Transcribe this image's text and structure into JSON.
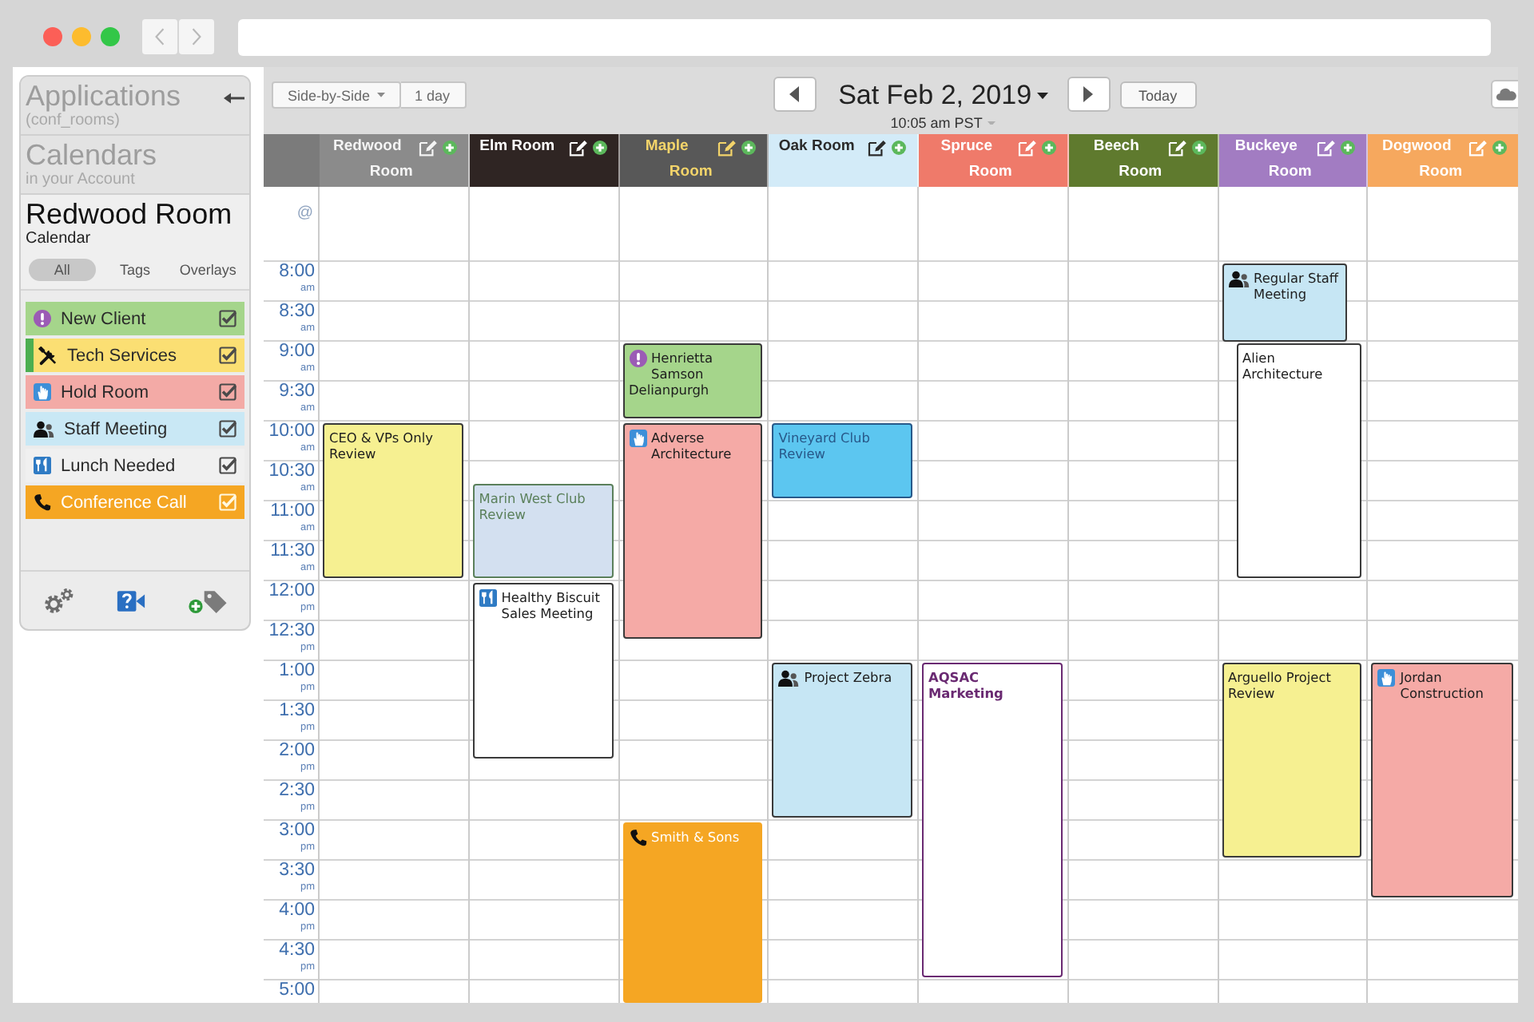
{
  "sidebar": {
    "sections": [
      {
        "title": "Applications",
        "subtitle": "(conf_rooms)",
        "selected": false,
        "collapse_arrow": true
      },
      {
        "title": "Calendars",
        "subtitle": "in your Account",
        "selected": false
      },
      {
        "title": "Redwood Room",
        "subtitle": "Calendar",
        "selected": true
      }
    ],
    "filters": [
      {
        "label": "All",
        "selected": true
      },
      {
        "label": "Tags",
        "selected": false
      },
      {
        "label": "Overlays",
        "selected": false
      }
    ],
    "tags": [
      {
        "label": "New Client",
        "kind": "new_client",
        "color": "#a5d58b",
        "checked": true,
        "selected": false
      },
      {
        "label": "Tech Services",
        "kind": "tech_services",
        "color": "#fbdf73",
        "checked": true,
        "selected": true
      },
      {
        "label": "Hold Room",
        "kind": "hold_room",
        "color": "#f3aaa6",
        "checked": true,
        "selected": false
      },
      {
        "label": "Staff Meeting",
        "kind": "staff_meeting",
        "color": "#c9e8f5",
        "checked": true,
        "selected": false
      },
      {
        "label": "Lunch Needed",
        "kind": "lunch_needed",
        "color": "#f0f0f0",
        "checked": true,
        "selected": false
      },
      {
        "label": "Conference Call",
        "kind": "conference_call",
        "color": "#f5a623",
        "checked": true,
        "selected": false
      }
    ]
  },
  "toolbar": {
    "views": [
      {
        "label": "Side-by-Side",
        "has_menu": true
      },
      {
        "label": "1 day"
      }
    ],
    "date": "Sat Feb 2, 2019",
    "timezone": "10:05 am PST",
    "today": "Today"
  },
  "calendar": {
    "all_day_marker": "@",
    "time_slots": [
      {
        "time": "8:00",
        "meridiem": "am"
      },
      {
        "time": "8:30",
        "meridiem": "am"
      },
      {
        "time": "9:00",
        "meridiem": "am"
      },
      {
        "time": "9:30",
        "meridiem": "am"
      },
      {
        "time": "10:00",
        "meridiem": "am"
      },
      {
        "time": "10:30",
        "meridiem": "am"
      },
      {
        "time": "11:00",
        "meridiem": "am"
      },
      {
        "time": "11:30",
        "meridiem": "am"
      },
      {
        "time": "12:00",
        "meridiem": "pm"
      },
      {
        "time": "12:30",
        "meridiem": "pm"
      },
      {
        "time": "1:00",
        "meridiem": "pm"
      },
      {
        "time": "1:30",
        "meridiem": "pm"
      },
      {
        "time": "2:00",
        "meridiem": "pm"
      },
      {
        "time": "2:30",
        "meridiem": "pm"
      },
      {
        "time": "3:00",
        "meridiem": "pm"
      },
      {
        "time": "3:30",
        "meridiem": "pm"
      },
      {
        "time": "4:00",
        "meridiem": "pm"
      },
      {
        "time": "4:30",
        "meridiem": "pm"
      },
      {
        "time": "5:00"
      }
    ],
    "rooms": [
      {
        "label": {
          "text": "Redwood Room",
          "color": "#f4f4f4"
        },
        "color": "#8b8b8b",
        "events": [
          {
            "title": {
              "text": "CEO & VPs Only Review"
            },
            "kind": "none",
            "color": "#f6f091"
          }
        ]
      },
      {
        "label": {
          "text": "Elm Room",
          "color": "#ffffff"
        },
        "color": "#2f2523",
        "events": [
          {
            "title": {
              "text": "Marin West Club Review",
              "color": "#5b805b"
            },
            "kind": "none",
            "color": "#d3e0f0"
          },
          {
            "title": {
              "text": "Healthy Biscuit Sales Meeting"
            },
            "kind": "lunch_needed",
            "color": "#ffffff"
          }
        ]
      },
      {
        "label": {
          "text": "Maple Room",
          "color": "#f3d46a"
        },
        "color": "#585858",
        "events": [
          {
            "title": {
              "text": "Henrietta Samson Delianpurgh"
            },
            "kind": "new_client",
            "color": "#a5d58b"
          },
          {
            "title": {
              "text": "Adverse Architecture"
            },
            "kind": "hold_room",
            "color": "#f5aaa6"
          },
          {
            "title": {
              "text": "Smith & Sons"
            },
            "kind": "conference_call",
            "color": "#f5a623"
          }
        ]
      },
      {
        "label": {
          "text": "Oak Room",
          "color": "#2b2b2b"
        },
        "color": "#d3ebf8",
        "events": [
          {
            "title": {
              "text": "Vineyard Club Review",
              "color": "#28598a"
            },
            "kind": "none",
            "color": "#5cc6f0"
          },
          {
            "title": {
              "text": "Project Zebra"
            },
            "kind": "staff_meeting",
            "color": "#c6e6f4"
          }
        ]
      },
      {
        "label": {
          "text": "Spruce Room",
          "color": "#ffffff"
        },
        "color": "#ef7a6a",
        "events": [
          {
            "title": {
              "text": "AQSAC Marketing",
              "color": "#6a2a72"
            },
            "kind": "none",
            "color": "#ffffff",
            "bold": true
          }
        ]
      },
      {
        "label": {
          "text": "Beech Room",
          "color": "#ffffff"
        },
        "color": "#5f7a2e"
      },
      {
        "label": {
          "text": "Buckeye Room",
          "color": "#ffffff"
        },
        "color": "#a27cc2",
        "events": [
          {
            "title": {
              "text": "Regular Staff Meeting"
            },
            "kind": "staff_meeting",
            "color": "#c6e6f4"
          },
          {
            "title": {
              "text": "Alien Architecture"
            },
            "kind": "none",
            "color": "#ffffff"
          },
          {
            "title": {
              "text": "Arguello Project Review"
            },
            "kind": "none",
            "color": "#f6f091"
          }
        ]
      },
      {
        "label": {
          "text": "Dogwood Room",
          "color": "#ffffff"
        },
        "color": "#f6a85e",
        "events": [
          {
            "title": {
              "text": "Jordan Construction"
            },
            "kind": "hold_room",
            "color": "#f5aaa6"
          }
        ]
      }
    ]
  }
}
